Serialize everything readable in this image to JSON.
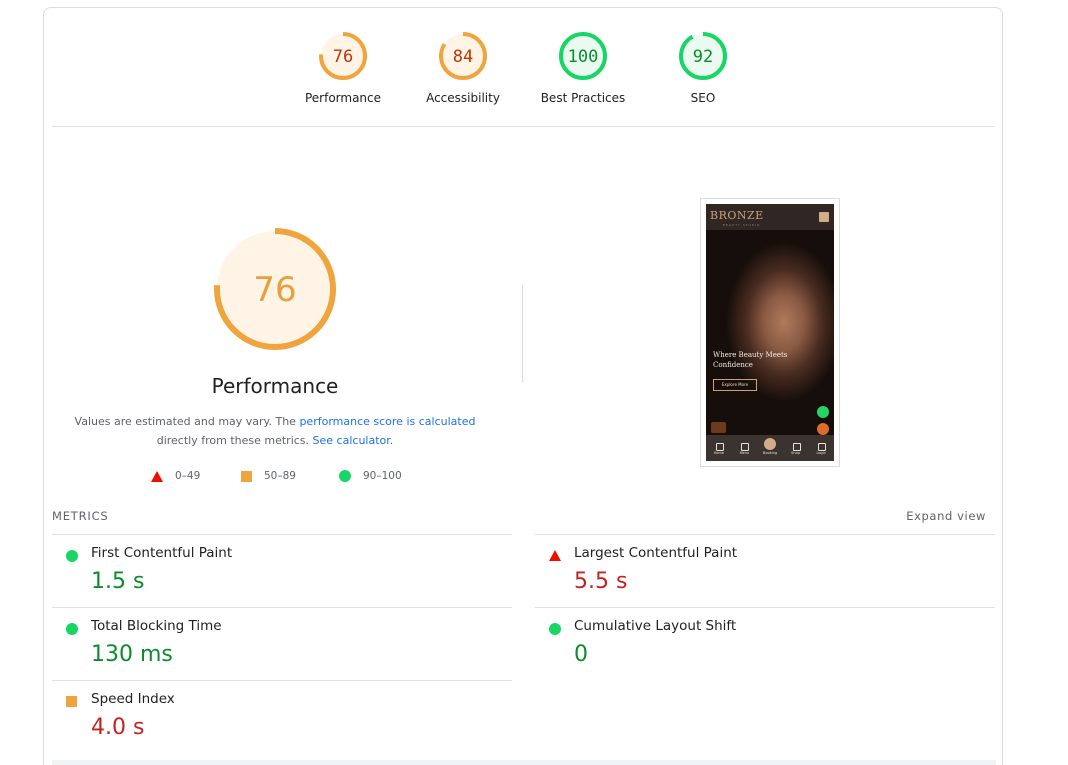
{
  "gauges": [
    {
      "score": "76",
      "label": "Performance",
      "fraction": 0.76,
      "ring": "#f0a43d",
      "fill": "#fff4e6",
      "text": "#c33300"
    },
    {
      "score": "84",
      "label": "Accessibility",
      "fraction": 0.84,
      "ring": "#f0a43d",
      "fill": "#fff4e6",
      "text": "#c33300"
    },
    {
      "score": "100",
      "label": "Best Practices",
      "fraction": 1.0,
      "ring": "#18d665",
      "fill": "#eafaf0",
      "text": "#0c8c2c"
    },
    {
      "score": "92",
      "label": "SEO",
      "fraction": 0.92,
      "ring": "#18d665",
      "fill": "#eafaf0",
      "text": "#0c8c2c"
    }
  ],
  "main_gauge": {
    "score": "76",
    "fraction": 0.76,
    "title": "Performance",
    "ring": "#f0a43d",
    "fill": "#fff4e6",
    "text": "#e8a03c"
  },
  "description": {
    "before": "Values are estimated and may vary. The ",
    "link1": "performance score is calculated",
    "middle": " directly from these metrics. ",
    "link2": "See calculator."
  },
  "legend": [
    {
      "shape": "triangle-icon",
      "label": "0–49",
      "color": "#eb0f00"
    },
    {
      "shape": "square-icon",
      "label": "50–89",
      "color": "#f0a43d"
    },
    {
      "shape": "circle-icon",
      "label": "90–100",
      "color": "#18d665"
    }
  ],
  "screenshot": {
    "logo": "BRONZE",
    "logo_sub": "BEAUTY STUDIO",
    "hero": "Where Beauty Meets Confidence",
    "button": "Explore More",
    "nav": [
      "Home",
      "Menu",
      "Booking",
      "Shop",
      "Login"
    ]
  },
  "metrics_header": {
    "title": "METRICS",
    "expand": "Expand view"
  },
  "metrics": [
    {
      "name": "First Contentful Paint",
      "value": "1.5 s",
      "status": "good"
    },
    {
      "name": "Largest Contentful Paint",
      "value": "5.5 s",
      "status": "poor"
    },
    {
      "name": "Total Blocking Time",
      "value": "130 ms",
      "status": "good"
    },
    {
      "name": "Cumulative Layout Shift",
      "value": "0",
      "status": "good"
    },
    {
      "name": "Speed Index",
      "value": "4.0 s",
      "status": "average"
    }
  ]
}
